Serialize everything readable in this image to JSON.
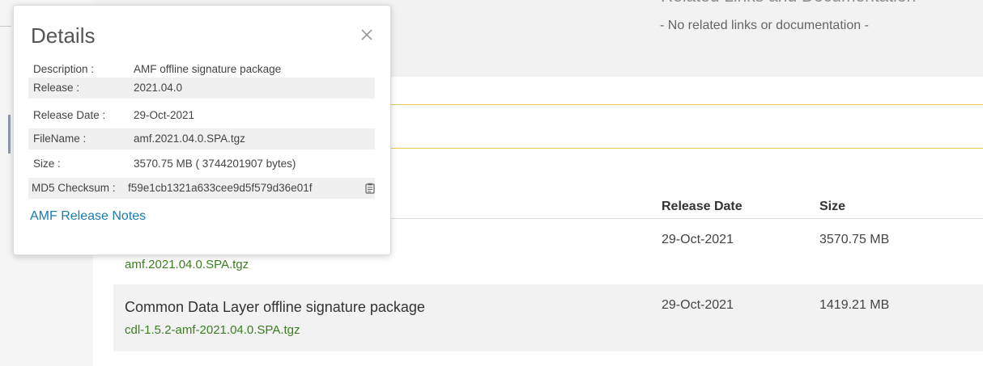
{
  "background": {
    "related_heading": "Related Links and Documentation",
    "related_empty": "- No related links or documentation -"
  },
  "table": {
    "columns": {
      "release_date": "Release Date",
      "size": "Size"
    },
    "rows": [
      {
        "description": "",
        "file": "amf.2021.04.0.SPA.tgz",
        "release_date": "29-Oct-2021",
        "size": "3570.75 MB"
      },
      {
        "description": "Common Data Layer offline signature package",
        "file": "cdl-1.5.2-amf-2021.04.0.SPA.tgz",
        "release_date": "29-Oct-2021",
        "size": "1419.21 MB"
      }
    ]
  },
  "details": {
    "title": "Details",
    "close_icon": "close-icon",
    "copy_icon": "clipboard-icon",
    "rows": [
      {
        "label": "Description :",
        "value": "AMF offline signature package"
      },
      {
        "label": "Release :",
        "value": "2021.04.0"
      },
      {
        "label": "Release Date :",
        "value": "29-Oct-2021"
      },
      {
        "label": "FileName :",
        "value": "amf.2021.04.0.SPA.tgz"
      },
      {
        "label": "Size :",
        "value": "3570.75 MB ( 3744201907 bytes)"
      }
    ],
    "md5_label": "MD5 Checksum :",
    "md5_value": "f59e1cb1321a633cee9d5f579d36e01f",
    "release_notes_link": "AMF Release Notes"
  },
  "colors": {
    "link": "#1a7bb0",
    "file_link": "#3c7d22",
    "highlight_border": "#f0c850"
  }
}
